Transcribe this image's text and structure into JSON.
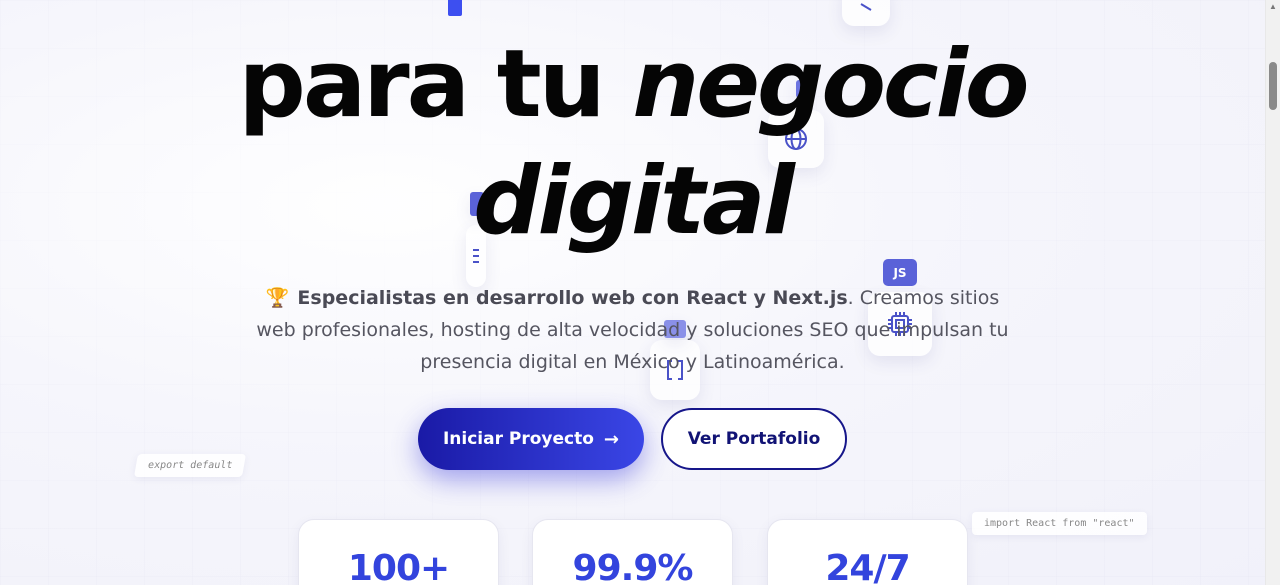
{
  "hero": {
    "headline_prefix": "para tu ",
    "headline_em": "negocio",
    "headline_line2": "digital",
    "description_bold": "Especialistas en desarrollo web con React y Next.js",
    "description_rest": ". Creamos sitios web profesionales, hosting de alta velocidad y soluciones SEO que impulsan tu presencia digital en México y Latinoamérica.",
    "trophy_icon": "🏆"
  },
  "buttons": {
    "primary_label": "Iniciar Proyecto",
    "primary_arrow": "→",
    "secondary_label": "Ver Portafolio"
  },
  "stats": [
    {
      "value": "100+"
    },
    {
      "value": "99.9%"
    },
    {
      "value": "24/7"
    }
  ],
  "decor": {
    "code_chip_1": "export default",
    "code_chip_2": "import React from \"react\"",
    "js_badge": "JS",
    "icons": [
      "globe-icon",
      "cpu-icon",
      "brackets-icon",
      "code-icon"
    ]
  },
  "colors": {
    "primary": "#3a46e6",
    "primary_dark": "#1a1aa6",
    "secondary_border": "#16168a",
    "stat_value": "#3344dd"
  }
}
